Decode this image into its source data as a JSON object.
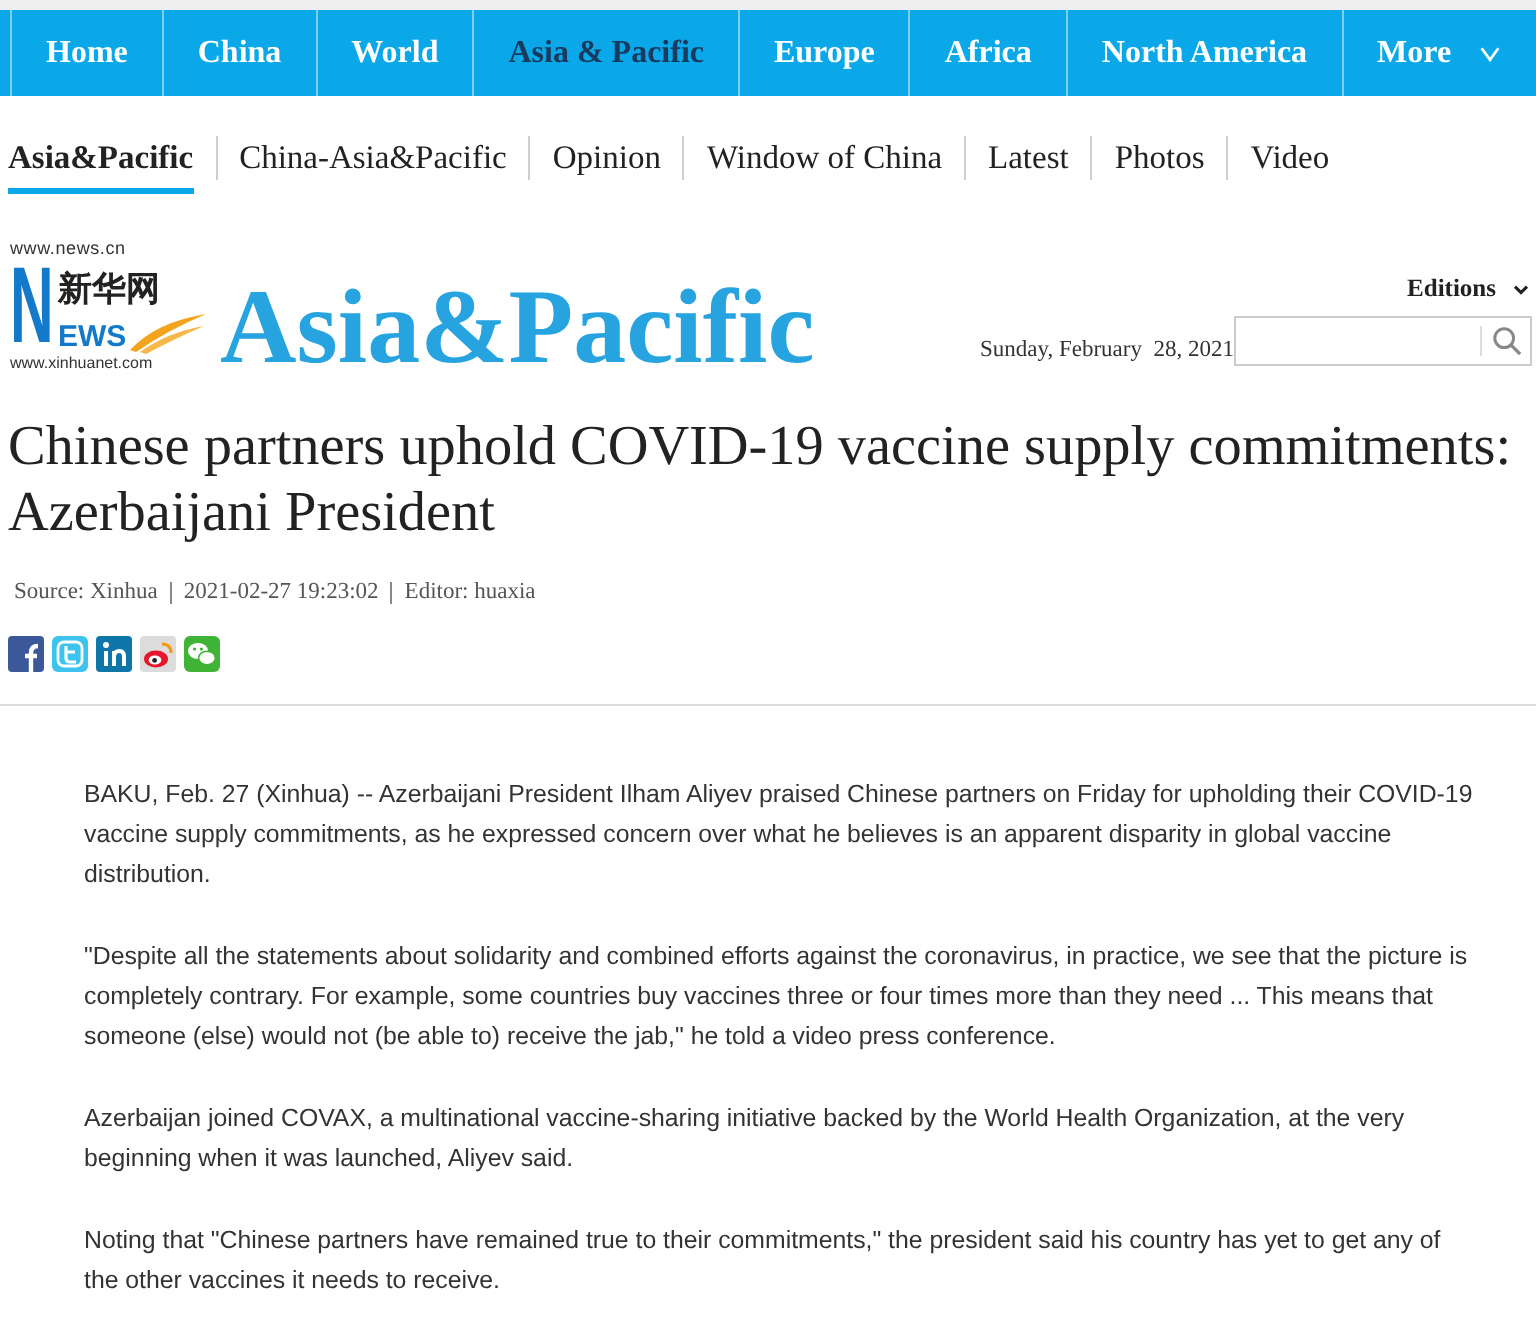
{
  "top_nav": {
    "items": [
      {
        "label": "Home",
        "kind": "link",
        "selected": false
      },
      {
        "label": "China",
        "kind": "link",
        "selected": false
      },
      {
        "label": "World",
        "kind": "link",
        "selected": false
      },
      {
        "label": "Asia & Pacific",
        "kind": "link",
        "selected": true
      },
      {
        "label": "Europe",
        "kind": "link",
        "selected": false
      },
      {
        "label": "Africa",
        "kind": "link",
        "selected": false
      },
      {
        "label": "North America",
        "kind": "link",
        "selected": false
      },
      {
        "label": "More",
        "kind": "dropdown",
        "selected": false
      }
    ]
  },
  "section_nav": {
    "items": [
      {
        "label": "Asia&Pacific",
        "selected": true
      },
      {
        "label": "China-Asia&Pacific",
        "selected": false
      },
      {
        "label": "Opinion",
        "selected": false
      },
      {
        "label": "Window of China",
        "selected": false
      },
      {
        "label": "Latest",
        "selected": false
      },
      {
        "label": "Photos",
        "selected": false
      },
      {
        "label": "Video",
        "selected": false
      }
    ]
  },
  "logo": {
    "domain": "www.news.cn",
    "chinese_name": "新华网",
    "initial": "N",
    "rest": "EWS",
    "site": "www.xinhuanet.com"
  },
  "section_title": "Asia&Pacific",
  "editions": {
    "label": "Editions"
  },
  "date": "Sunday, February  28, 2021",
  "article": {
    "headline": "Chinese partners uphold COVID-19 vaccine supply commitments: Azerbaijani President",
    "source": "Source: Xinhua",
    "datetime": "2021-02-27 19:23:02",
    "editor": "Editor: huaxia",
    "paragraphs": [
      "BAKU, Feb. 27 (Xinhua) -- Azerbaijani President Ilham Aliyev praised Chinese partners on Friday for upholding their COVID-19 vaccine supply commitments, as he expressed concern over what he believes is an apparent disparity in global vaccine distribution.",
      "\"Despite all the statements about solidarity and combined efforts against the coronavirus, in practice, we see that the picture is completely contrary. For example, some countries buy vaccines three or four times more than they need ... This means that someone (else) would not (be able to) receive the jab,\" he told a video press conference.",
      "Azerbaijan joined COVAX, a multinational vaccine-sharing initiative backed by the World Health Organization, at the very beginning when it was launched, Aliyev said.",
      "Noting that \"Chinese partners have remained true to their commitments,\" the president said his country has yet to get any of the other vaccines it needs to receive."
    ]
  }
}
